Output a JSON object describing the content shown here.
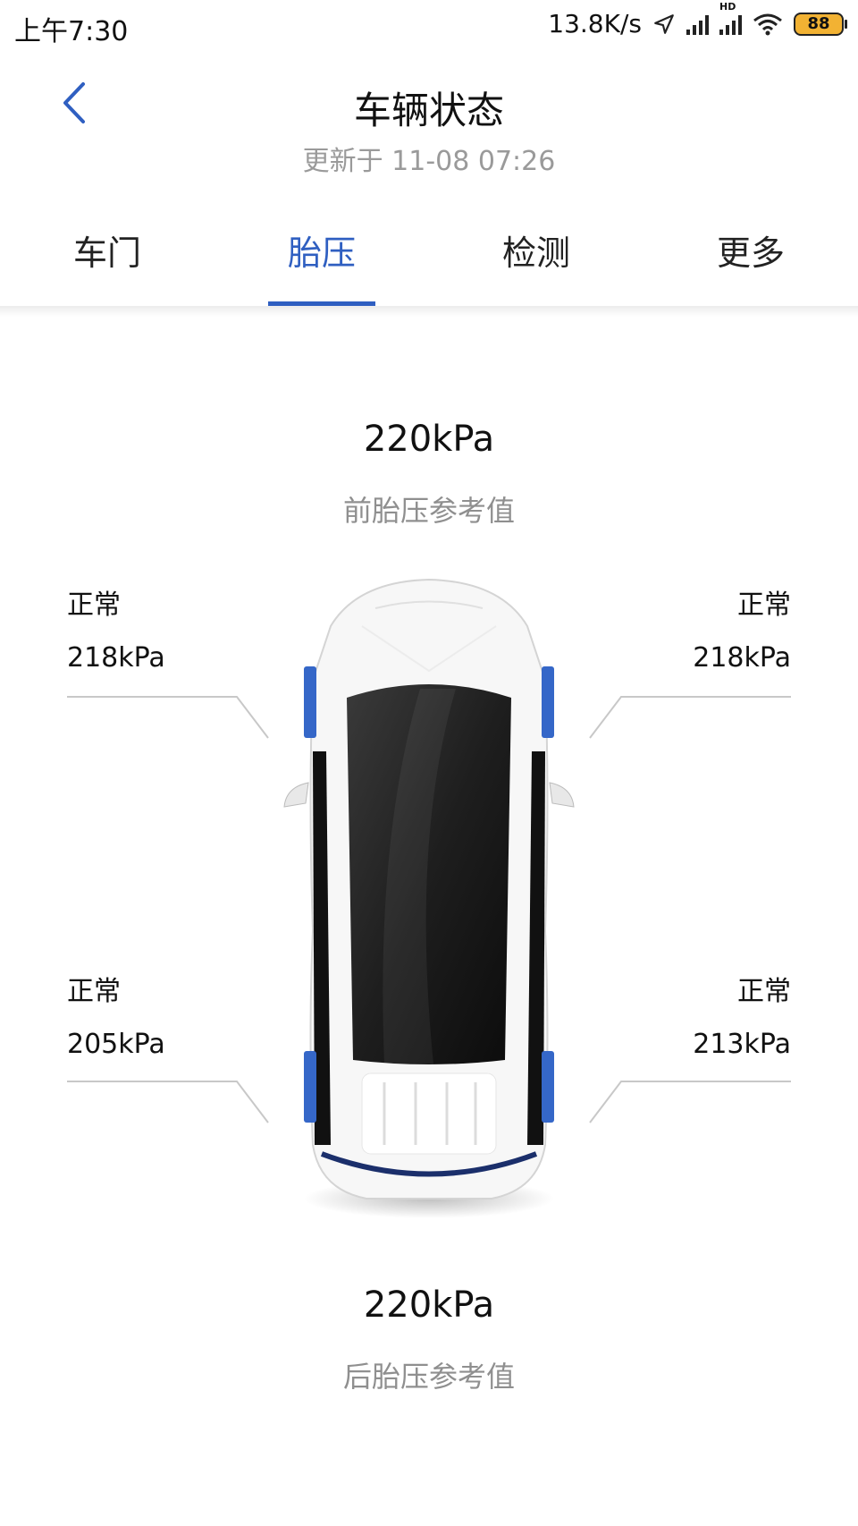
{
  "status_bar": {
    "time": "上午7:30",
    "net_speed": "13.8K/s",
    "hd_label": "HD",
    "battery": "88"
  },
  "header": {
    "title": "车辆状态",
    "updated": "更新于 11-08 07:26"
  },
  "tabs": [
    {
      "label": "车门",
      "active": false
    },
    {
      "label": "胎压",
      "active": true
    },
    {
      "label": "检测",
      "active": false
    },
    {
      "label": "更多",
      "active": false
    }
  ],
  "front_reference": {
    "value": "220kPa",
    "label": "前胎压参考值"
  },
  "rear_reference": {
    "value": "220kPa",
    "label": "后胎压参考值"
  },
  "tires": {
    "front_left": {
      "status": "正常",
      "pressure": "218kPa"
    },
    "front_right": {
      "status": "正常",
      "pressure": "218kPa"
    },
    "rear_left": {
      "status": "正常",
      "pressure": "205kPa"
    },
    "rear_right": {
      "status": "正常",
      "pressure": "213kPa"
    }
  },
  "colors": {
    "accent": "#2f5fc1",
    "tire_highlight": "#3567c8",
    "secondary_text": "#8f8f8f"
  },
  "icons": {
    "back": "chevron-left-icon",
    "location": "navigation-arrow-icon",
    "signal": "signal-bars-icon",
    "wifi": "wifi-icon",
    "battery": "battery-icon"
  }
}
